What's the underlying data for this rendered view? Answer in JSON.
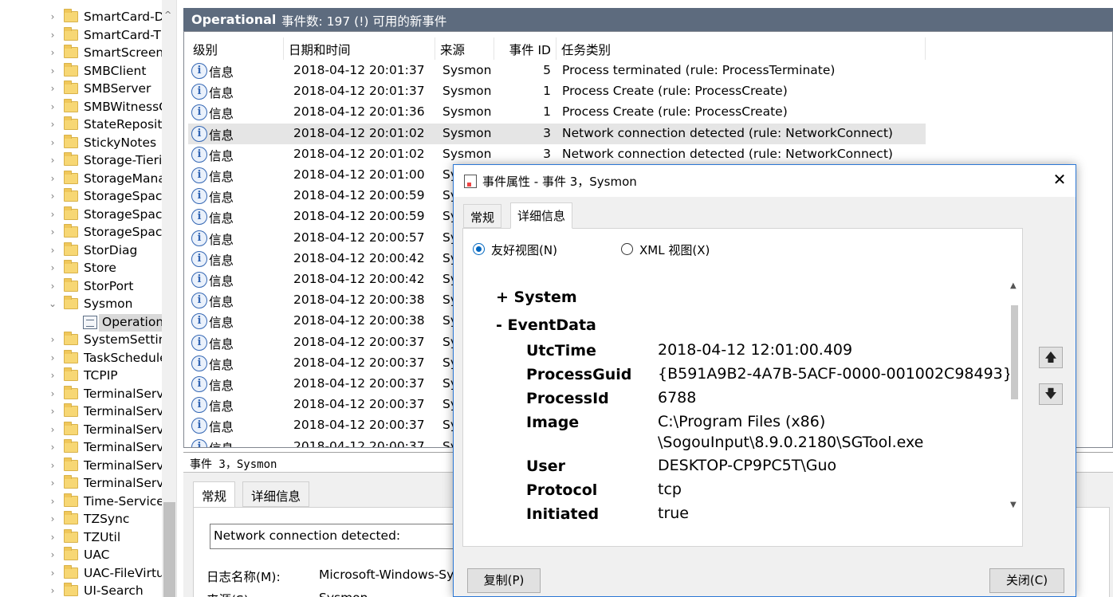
{
  "tree": {
    "items": [
      {
        "label": "SmartCard-De",
        "chevron": "›"
      },
      {
        "label": "SmartCard-TP",
        "chevron": "›"
      },
      {
        "label": "SmartScreen",
        "chevron": "›"
      },
      {
        "label": "SMBClient",
        "chevron": "›"
      },
      {
        "label": "SMBServer",
        "chevron": "›"
      },
      {
        "label": "SMBWitnessC",
        "chevron": "›"
      },
      {
        "label": "StateReposito",
        "chevron": "›"
      },
      {
        "label": "StickyNotes",
        "chevron": "›"
      },
      {
        "label": "Storage-Tierin",
        "chevron": "›"
      },
      {
        "label": "StorageManag",
        "chevron": "›"
      },
      {
        "label": "StorageSpace:",
        "chevron": "›"
      },
      {
        "label": "StorageSpace:",
        "chevron": "›"
      },
      {
        "label": "StorageSpace:",
        "chevron": "›"
      },
      {
        "label": "StorDiag",
        "chevron": "›"
      },
      {
        "label": "Store",
        "chevron": "›"
      },
      {
        "label": "StorPort",
        "chevron": "›"
      },
      {
        "label": "Sysmon",
        "chevron": "⌄"
      },
      {
        "label": "Operationa",
        "chevron": ""
      },
      {
        "label": "SystemSetting",
        "chevron": "›"
      },
      {
        "label": "TaskSchedule",
        "chevron": "›"
      },
      {
        "label": "TCPIP",
        "chevron": "›"
      },
      {
        "label": "TerminalServi",
        "chevron": "›"
      },
      {
        "label": "TerminalServi",
        "chevron": "›"
      },
      {
        "label": "TerminalServi",
        "chevron": "›"
      },
      {
        "label": "TerminalServi",
        "chevron": "›"
      },
      {
        "label": "TerminalServi",
        "chevron": "›"
      },
      {
        "label": "TerminalServi",
        "chevron": "›"
      },
      {
        "label": "Time-Service",
        "chevron": "›"
      },
      {
        "label": "TZSync",
        "chevron": "›"
      },
      {
        "label": "TZUtil",
        "chevron": "›"
      },
      {
        "label": "UAC",
        "chevron": "›"
      },
      {
        "label": "UAC-FileVirtu",
        "chevron": "›"
      },
      {
        "label": "UI-Search",
        "chevron": "›"
      }
    ],
    "scroll_up": "^"
  },
  "header": {
    "log_name": "Operational",
    "summary": "事件数: 197 (!) 可用的新事件"
  },
  "grid": {
    "columns": [
      "级别",
      "日期和时间",
      "来源",
      "事件 ID",
      "任务类别"
    ],
    "rows": [
      {
        "level": "信息",
        "datetime": "2018-04-12 20:01:37",
        "source": "Sysmon",
        "id": "5",
        "task": "Process terminated (rule: ProcessTerminate)"
      },
      {
        "level": "信息",
        "datetime": "2018-04-12 20:01:37",
        "source": "Sysmon",
        "id": "1",
        "task": "Process Create (rule: ProcessCreate)"
      },
      {
        "level": "信息",
        "datetime": "2018-04-12 20:01:36",
        "source": "Sysmon",
        "id": "1",
        "task": "Process Create (rule: ProcessCreate)"
      },
      {
        "level": "信息",
        "datetime": "2018-04-12 20:01:02",
        "source": "Sysmon",
        "id": "3",
        "task": "Network connection detected (rule: NetworkConnect)"
      },
      {
        "level": "信息",
        "datetime": "2018-04-12 20:01:02",
        "source": "Sysmon",
        "id": "3",
        "task": "Network connection detected (rule: NetworkConnect)"
      },
      {
        "level": "信息",
        "datetime": "2018-04-12 20:01:00",
        "source": "Sy",
        "id": "",
        "task": ""
      },
      {
        "level": "信息",
        "datetime": "2018-04-12 20:00:59",
        "source": "Sy",
        "id": "",
        "task": ""
      },
      {
        "level": "信息",
        "datetime": "2018-04-12 20:00:59",
        "source": "Sy",
        "id": "",
        "task": ""
      },
      {
        "level": "信息",
        "datetime": "2018-04-12 20:00:57",
        "source": "Sy",
        "id": "",
        "task": ""
      },
      {
        "level": "信息",
        "datetime": "2018-04-12 20:00:42",
        "source": "Sy",
        "id": "",
        "task": ""
      },
      {
        "level": "信息",
        "datetime": "2018-04-12 20:00:42",
        "source": "Sy",
        "id": "",
        "task": ""
      },
      {
        "level": "信息",
        "datetime": "2018-04-12 20:00:38",
        "source": "Sy",
        "id": "",
        "task": ""
      },
      {
        "level": "信息",
        "datetime": "2018-04-12 20:00:38",
        "source": "Sy",
        "id": "",
        "task": ""
      },
      {
        "level": "信息",
        "datetime": "2018-04-12 20:00:37",
        "source": "Sy",
        "id": "",
        "task": ""
      },
      {
        "level": "信息",
        "datetime": "2018-04-12 20:00:37",
        "source": "Sy",
        "id": "",
        "task": ""
      },
      {
        "level": "信息",
        "datetime": "2018-04-12 20:00:37",
        "source": "Sy",
        "id": "",
        "task": ""
      },
      {
        "level": "信息",
        "datetime": "2018-04-12 20:00:37",
        "source": "Sy",
        "id": "",
        "task": ""
      },
      {
        "level": "信息",
        "datetime": "2018-04-12 20:00:37",
        "source": "Sy",
        "id": "",
        "task": ""
      },
      {
        "level": "信息",
        "datetime": "2018-04-12 20:00:37",
        "source": "Sy",
        "id": "",
        "task": ""
      }
    ],
    "info_icon_glyph": "i"
  },
  "lower": {
    "title": "事件 3，Sysmon",
    "tabs": [
      "常规",
      "详细信息"
    ],
    "description": "Network connection detected:",
    "log_label": "日志名称(M):",
    "log_value": "Microsoft-Windows-Sysm",
    "source_label": "来源(S):",
    "source_value": "Sysmon"
  },
  "dialog": {
    "title": "事件属性 - 事件 3，Sysmon",
    "close_glyph": "✕",
    "tabs": [
      "常规",
      "详细信息"
    ],
    "radio_friendly": "友好视图(N)",
    "radio_xml": "XML 视图(X)",
    "system_label": "+  System",
    "eventdata_label": "-  EventData",
    "fields": [
      {
        "key": "UtcTime",
        "value": "2018-04-12 12:01:00.409"
      },
      {
        "key": "ProcessGuid",
        "value": "{B591A9B2-4A7B-5ACF-0000-001002C98493}"
      },
      {
        "key": "ProcessId",
        "value": "6788"
      },
      {
        "key": "Image",
        "value": "C:\\Program Files (x86)",
        "value2": "\\SogouInput\\8.9.0.2180\\SGTool.exe"
      },
      {
        "key": "User",
        "value": "DESKTOP-CP9PC5T\\Guo"
      },
      {
        "key": "Protocol",
        "value": "tcp"
      },
      {
        "key": "Initiated",
        "value": "true"
      }
    ],
    "up_glyph": "🡅",
    "down_glyph": "🡇",
    "copy_button": "复制(P)",
    "close_button": "关闭(C)"
  },
  "colors": {
    "header_bg": "#5d6b7e",
    "selection": "#e5e5e5",
    "accent": "#0067c0",
    "info_icon": "#3366b3"
  }
}
